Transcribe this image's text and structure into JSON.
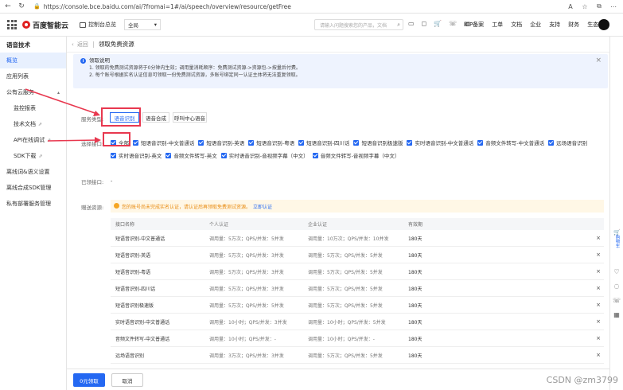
{
  "browser": {
    "url": "https://console.bce.baidu.com/ai/?fromai=1#/ai/speech/overview/resource/getFree"
  },
  "topnav": {
    "logo_text": "百度智能云",
    "console_label": "控制台总览",
    "region": "全局",
    "search_placeholder": "请输入问题搜索您的产品，文档",
    "links": [
      "ICP备案",
      "工单",
      "文档",
      "企业",
      "支持",
      "财务",
      "生态"
    ]
  },
  "sidebar": {
    "title": "语音技术",
    "items": [
      {
        "label": "概览",
        "active": true
      },
      {
        "label": "应用列表"
      },
      {
        "label": "公有云服务"
      },
      {
        "label": "监控报表"
      },
      {
        "label": "技术文档"
      },
      {
        "label": "API在线调试"
      },
      {
        "label": "SDK下载"
      },
      {
        "label": "离线词&语义设置"
      },
      {
        "label": "离线合成SDK管理"
      },
      {
        "label": "私有部署服务管理"
      }
    ]
  },
  "breadcrumb": {
    "back": "返回",
    "title": "领取免费资源"
  },
  "notice": {
    "title": "领取说明",
    "lines": [
      "1. 领取的免费测试资源将于0分钟内生效；调用量消耗顺序：免费测试资源->资源包->按量后付费。",
      "2. 每个账号根据实名认证信息可领取一份免费测试资源，多账号绑定同一认证主体将无法重复领取。"
    ]
  },
  "form": {
    "service_type_label": "服务类型:",
    "service_tabs": [
      "语音识别",
      "语音合成",
      "呼叫中心语音"
    ],
    "interface_label": "选择接口:",
    "interfaces_row1": [
      "全部",
      "短语音识别-中文普通话",
      "短语音识别-英语",
      "短语音识别-粤语",
      "短语音识别-四川话",
      "短语音识别极速版",
      "实时语音识别-中文普通话",
      "音频文件转写-中文普通话",
      "远场语音识别"
    ],
    "interfaces_row2": [
      "实时语音识别-英文",
      "音频文件转写-英文",
      "实时语音识别-音视频字幕（中文）",
      "音频文件转写-音视频字幕（中文）"
    ],
    "received_label": "已领接口:",
    "received_value": "-",
    "resource_label": "赠送资源:",
    "warning": "您的账号尚未完成实名认证，请认证后再领取免费测试资源。",
    "warning_link": "立即认证"
  },
  "table": {
    "headers": [
      "接口名称",
      "个人认证",
      "企业认证",
      "有效期"
    ],
    "rows": [
      [
        "短语音识别-中文普通话",
        "调用量：5万次；QPS/并发：5并发",
        "调用量：10万次；QPS/并发：10并发",
        "180天"
      ],
      [
        "短语音识别-英语",
        "调用量：5万次；QPS/并发：3并发",
        "调用量：5万次；QPS/并发：5并发",
        "180天"
      ],
      [
        "短语音识别-粤语",
        "调用量：5万次；QPS/并发：3并发",
        "调用量：5万次；QPS/并发：5并发",
        "180天"
      ],
      [
        "短语音识别-四川话",
        "调用量：5万次；QPS/并发：3并发",
        "调用量：5万次；QPS/并发：5并发",
        "180天"
      ],
      [
        "短语音识别极速版",
        "调用量：5万次；QPS/并发：5并发",
        "调用量：5万次；QPS/并发：5并发",
        "180天"
      ],
      [
        "实时语音识别-中文普通话",
        "调用量：10小时；QPS/并发：3并发",
        "调用量：10小时；QPS/并发：5并发",
        "180天"
      ],
      [
        "音频文件转写-中文普通话",
        "调用量：10小时；QPS/并发：-",
        "调用量：10小时；QPS/并发：-",
        "180天"
      ],
      [
        "远场语音识别",
        "调用量：3万次；QPS/并发：3并发",
        "调用量：5万次；QPS/并发：5并发",
        "180天"
      ]
    ]
  },
  "footer": {
    "primary": "0元领取",
    "cancel": "取消"
  },
  "rightbar": {
    "cart": "购物车"
  },
  "watermark": "CSDN @zm3799",
  "colors": {
    "accent": "#2468f2",
    "annotation": "#e8384f",
    "warning": "#e8890c"
  }
}
